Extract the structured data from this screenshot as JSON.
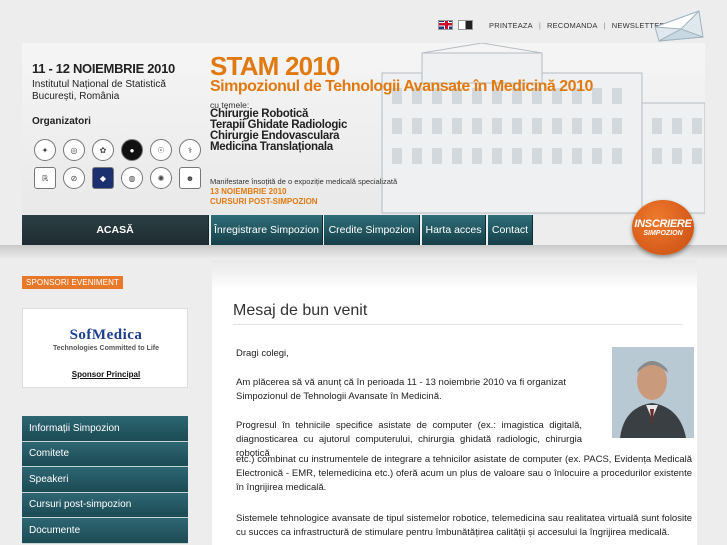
{
  "top": {
    "flags": [
      "english-flag",
      "romanian-flag"
    ],
    "links": [
      "PRINTEAZA",
      "RECOMANDA",
      "NEWSLETTER"
    ],
    "sep": "|"
  },
  "banner": {
    "date": "11 - 12 NOIEMBRIE 2010",
    "institute": [
      "Institutul Național de Statistică",
      "București, România"
    ],
    "organizers": "Organizatori",
    "title": "STAM 2010",
    "subtitle": "Simpozionul de Tehnologii Avansate în Medicină 2010",
    "themes_intro": "cu temele:",
    "themes": [
      "Chirurgie Robotică",
      "Terapii Ghidate Radiologic",
      "Chirurgie Endovasculara",
      "Medicina Translaționala"
    ],
    "expo": "Manifestare însoțită de o expoziție medicală specializată",
    "extra_date": "13 NOIEMBRIE 2010",
    "extra_label": "CURSURI POST-SIMPOZION"
  },
  "nav": {
    "acasa": "ACASĂ",
    "inregistrare": "Înregistrare Simpozion",
    "credite": "Credite Simpozion",
    "harta": "Harta acces",
    "contact": "Contact"
  },
  "inscriere": {
    "line1": "INSCRIERE",
    "line2": "SIMPOZION"
  },
  "sidebar": {
    "sponsori": "SPONSORI EVENIMENT",
    "sponsor_name": "SofMedica",
    "sponsor_tagline": "Technologies Committed to Life",
    "sponsor_label": "Sponsor Principal",
    "items": [
      "Informații Simpozion",
      "Comitete",
      "Speakeri",
      "Cursuri post-simpozion",
      "Documente"
    ]
  },
  "main": {
    "heading": "Mesaj de bun venit",
    "greeting": "Dragi colegi,",
    "p1": "Am plăcerea să vă anunț că în perioada 11 - 13 noiembrie 2010 va fi organizat Simpozionul de Tehnologii Avansate în Medicină.",
    "p2": "Progresul în tehnicile specifice asistate de computer (ex.: imagistica digitală, diagnosticarea cu ajutorul computerului, chirurgia ghidată radiologic, chirurgia robotică",
    "p3": "etc.) combinat cu instrumentele de integrare a tehnicilor asistate de computer (ex. PACS, Evidența Medicală Electronică - EMR, telemedicina etc.) oferă acum un plus de valoare sau o înlocuire a procedurilor existente în îngrijirea medicală.",
    "p4": "Sistemele tehnologice avansate de tipul sistemelor robotice, telemedicina sau realitatea virtuală sunt folosite cu succes ca infrastructură de stimulare pentru îmbunătățirea calității și accesului la îngrijirea medicală."
  }
}
